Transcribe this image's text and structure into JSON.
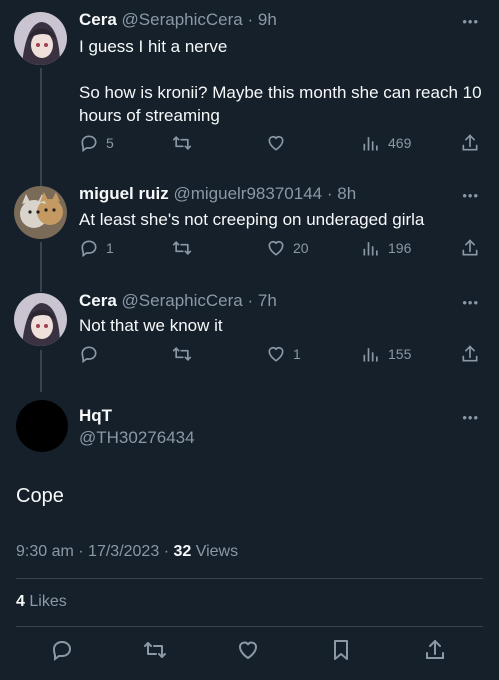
{
  "replies": [
    {
      "display_name": "Cera",
      "handle": "@SeraphicCera",
      "sep": "·",
      "time": "9h",
      "text": "I guess I hit a nerve\n\nSo how is kronii? Maybe this month she can reach 10 hours of streaming",
      "replies": "5",
      "retweets": "",
      "likes": "",
      "views": "469"
    },
    {
      "display_name": "miguel ruiz",
      "handle": "@miguelr98370144",
      "sep": "·",
      "time": "8h",
      "text": "At least she's not creeping on underaged girla",
      "replies": "1",
      "retweets": "",
      "likes": "20",
      "views": "196"
    },
    {
      "display_name": "Cera",
      "handle": "@SeraphicCera",
      "sep": "·",
      "time": "7h",
      "text": "Not that we know it",
      "replies": "",
      "retweets": "",
      "likes": "1",
      "views": "155"
    }
  ],
  "main_tweet": {
    "display_name": "HqT",
    "handle": "@TH30276434",
    "text": "Cope",
    "time": "9:30 am",
    "date": "17/3/2023",
    "sep": "·",
    "views_count": "32",
    "views_label": "Views",
    "likes_count": "4",
    "likes_label": "Likes"
  },
  "more_glyph": "•••",
  "colors": {
    "background": "#15202b",
    "text": "#f7f9f9",
    "muted": "#8b98a5",
    "divider": "#38444d"
  }
}
